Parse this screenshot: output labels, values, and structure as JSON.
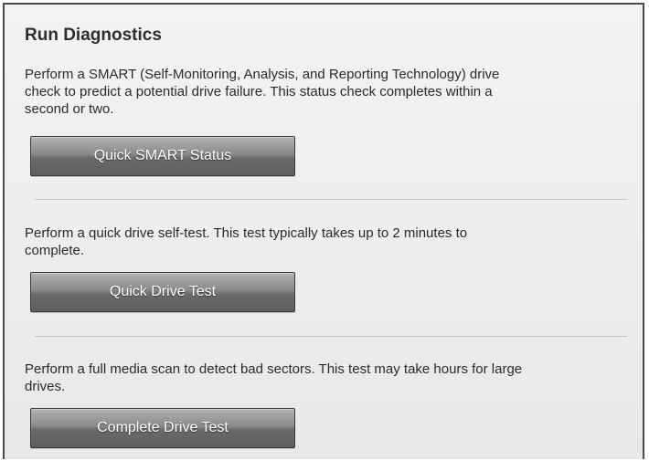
{
  "panel": {
    "title": "Run Diagnostics"
  },
  "sections": [
    {
      "description_lines": [
        "Perform a SMART (Self-Monitoring, Analysis, and Reporting Technology) drive",
        "check to predict a potential drive failure. This status check completes within a",
        "second or two."
      ],
      "button_label": "Quick SMART Status"
    },
    {
      "description_lines": [
        "Perform a quick drive self-test. This test typically takes up to 2 minutes to",
        "complete."
      ],
      "button_label": "Quick Drive Test"
    },
    {
      "description_lines": [
        "Perform a full media scan to detect bad sectors. This test may take hours for large",
        "drives."
      ],
      "button_label": "Complete Drive Test"
    }
  ]
}
